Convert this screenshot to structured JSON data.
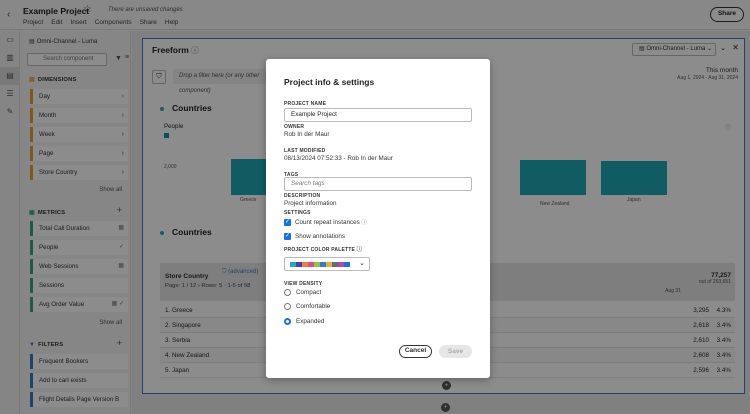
{
  "header": {
    "project_title": "Example Project",
    "unsaved": "There are unsaved changes",
    "menu": [
      "Project",
      "Edit",
      "Insert",
      "Components",
      "Share",
      "Help"
    ],
    "share_label": "Share"
  },
  "panel": {
    "report_suite": "Omni-Channel - Luma",
    "search_placeholder": "Search component",
    "dimensions_title": "DIMENSIONS",
    "dimensions": [
      "Day",
      "Month",
      "Week",
      "Page",
      "Store Country"
    ],
    "metrics_title": "METRICS",
    "metrics": [
      "Total Call Duration",
      "People",
      "Web Sessions",
      "Sessions",
      "Avg Order Value"
    ],
    "filters_title": "FILTERS",
    "filters": [
      "Frequent Bookers",
      "Add to cart exists",
      "Flight Details Page Version B"
    ],
    "show_all": "Show all"
  },
  "freeform": {
    "title": "Freeform",
    "report_suite": "Omni-Channel - Luma",
    "drop_placeholder": "Drop a filter here (or any other component)",
    "date_label": "This month",
    "date_range": "Aug 1, 2024 - Aug 31, 2024",
    "viz1_title": "Countries",
    "viz2_title": "Countries"
  },
  "chart_data": {
    "type": "bar",
    "legend": "People",
    "ytick": "2,000",
    "categories": [
      "Greece",
      "New Zealand",
      "Japan"
    ],
    "color": "#1fa8b5"
  },
  "table": {
    "dimension_header": "Store Country",
    "advanced": "(advanced)",
    "pagination": "Page:  1  / 12  ›  Rows:  5  · 1-5 of 58",
    "total_value": "77,257",
    "total_sub": "out of 263,651",
    "aug_label": "Aug 31",
    "rows": [
      {
        "name": "1.  Greece",
        "value": "3,295",
        "pct": "4.3%"
      },
      {
        "name": "2.  Singapore",
        "value": "2,618",
        "pct": "3.4%"
      },
      {
        "name": "3.  Serbia",
        "value": "2,610",
        "pct": "3.4%"
      },
      {
        "name": "4.  New Zealand",
        "value": "2,608",
        "pct": "3.4%"
      },
      {
        "name": "5.  Japan",
        "value": "2,596",
        "pct": "3.4%"
      }
    ]
  },
  "modal": {
    "title": "Project info & settings",
    "project_name_label": "PROJECT NAME",
    "project_name_value": "Example Project",
    "owner_label": "OWNER",
    "owner_value": "Rob In der Maur",
    "last_modified_label": "LAST MODIFIED",
    "last_modified_value": "08/13/2024 07:52:33 - Rob In der Maur",
    "tags_label": "TAGS",
    "tags_placeholder": "Search tags",
    "description_label": "DESCRIPTION",
    "description_value": "Project information",
    "settings_label": "SETTINGS",
    "count_repeat": "Count repeat instances",
    "show_annotations": "Show annotations",
    "palette_label": "PROJECT COLOR PALETTE",
    "palette_colors": [
      "#2aa8b9",
      "#4b3fa6",
      "#e8823c",
      "#d64e8a",
      "#8fc23f",
      "#3a79c5",
      "#d9b23a",
      "#6a6a6a",
      "#b046b5",
      "#1d6fd6"
    ],
    "density_label": "VIEW DENSITY",
    "density_options": [
      "Compact",
      "Comfortable",
      "Expanded"
    ],
    "cancel": "Cancel",
    "save": "Save"
  }
}
